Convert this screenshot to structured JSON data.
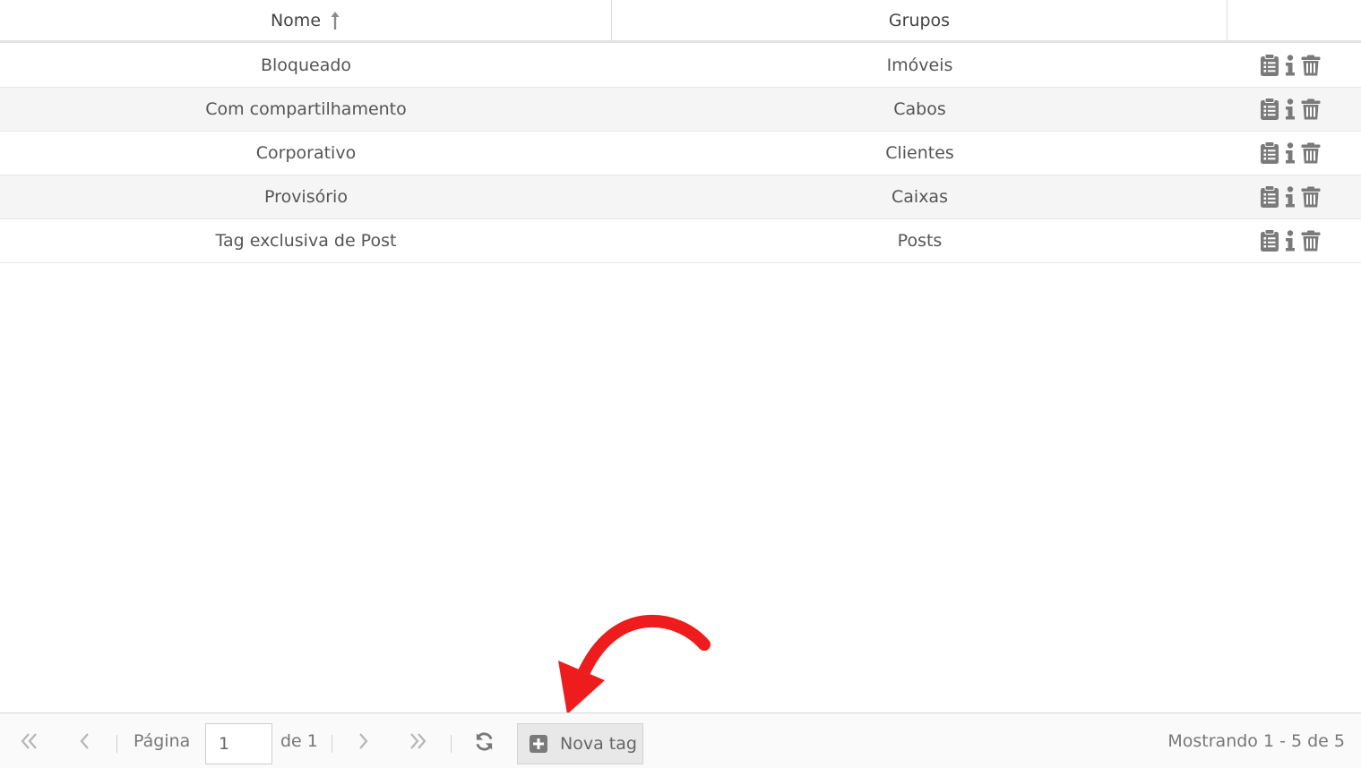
{
  "header": {
    "columns": [
      {
        "label": "Nome",
        "sorted": "ascending"
      },
      {
        "label": "Grupos"
      },
      {
        "label": ""
      }
    ]
  },
  "rows": [
    {
      "name": "Bloqueado",
      "group": "Imóveis"
    },
    {
      "name": "Com compartilhamento",
      "group": "Cabos"
    },
    {
      "name": "Corporativo",
      "group": "Clientes"
    },
    {
      "name": "Provisório",
      "group": "Caixas"
    },
    {
      "name": "Tag exclusiva de Post",
      "group": "Posts"
    }
  ],
  "row_actions": [
    "clipboard-list-icon",
    "info-icon",
    "trash-icon"
  ],
  "pagination": {
    "page_label": "Página",
    "page_value": "1",
    "of_label": "de 1",
    "new_button_label": "Nova tag",
    "summary": "Mostrando 1 - 5 de 5"
  },
  "colors": {
    "icon_gray": "#7a7a7a",
    "arrow_red": "#ee1c1c",
    "alt_row": "#f5f5f5"
  }
}
